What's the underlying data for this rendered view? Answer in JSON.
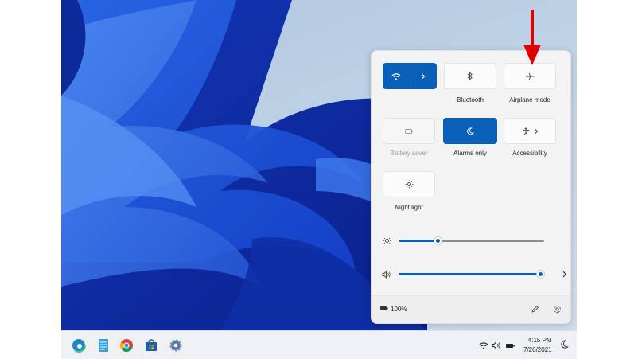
{
  "quick_settings": {
    "tiles": [
      {
        "label": "",
        "icon": "wifi-icon",
        "state": "on"
      },
      {
        "label": "Bluetooth",
        "icon": "bluetooth-icon",
        "state": "off"
      },
      {
        "label": "Airplane mode",
        "icon": "airplane-icon",
        "state": "off"
      },
      {
        "label": "Battery saver",
        "icon": "battery-saver-icon",
        "state": "disabled"
      },
      {
        "label": "Alarms only",
        "icon": "moon-icon",
        "state": "on"
      },
      {
        "label": "Accessibility",
        "icon": "accessibility-icon",
        "state": "off"
      },
      {
        "label": "Night light",
        "icon": "sun-icon",
        "state": "off"
      }
    ],
    "brightness": {
      "level": 0.27,
      "icon": "sun-icon"
    },
    "volume": {
      "level": 1.0,
      "icon": "speaker-icon"
    },
    "battery_text": "100%"
  },
  "taskbar": {
    "apps": [
      "edge-icon",
      "notepad-icon",
      "chrome-icon",
      "store-icon",
      "settings-icon"
    ],
    "time": "4:15 PM",
    "date": "7/26/2021"
  },
  "colors": {
    "accent": "#0a5fb8",
    "annotation_arrow": "#e00000"
  }
}
